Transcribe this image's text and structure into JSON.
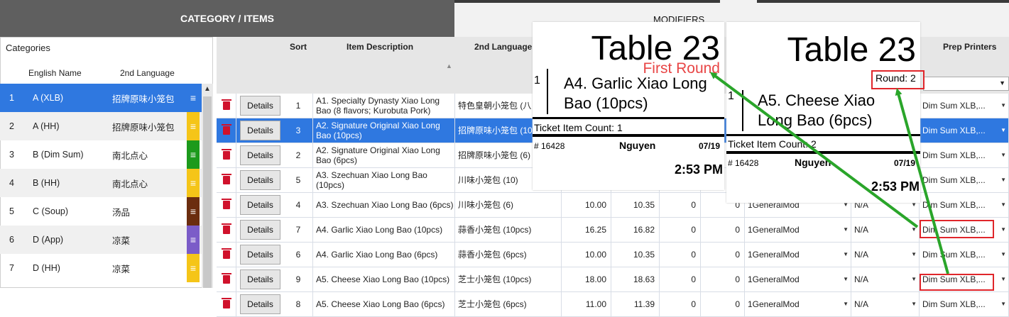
{
  "tabs": {
    "category_items": "CATEGORY / ITEMS",
    "modifiers": "MODIFIERS"
  },
  "categories": {
    "title": "Categories",
    "col_english": "English Name",
    "col_second": "2nd Language",
    "rows": [
      {
        "n": "1",
        "en": "A (XLB)",
        "l2": "招牌原味小笼包",
        "color": "#2f78e0",
        "selected": true
      },
      {
        "n": "2",
        "en": "A (HH)",
        "l2": "招牌原味小笼包",
        "color": "#f5c518"
      },
      {
        "n": "3",
        "en": "B (Dim Sum)",
        "l2": "南北点心",
        "color": "#1c9a1c"
      },
      {
        "n": "4",
        "en": "B (HH)",
        "l2": "南北点心",
        "color": "#f5c518"
      },
      {
        "n": "5",
        "en": "C (Soup)",
        "l2": "汤品",
        "color": "#6b2d0f"
      },
      {
        "n": "6",
        "en": "D (App)",
        "l2": "凉菜",
        "color": "#7b5cc8"
      },
      {
        "n": "7",
        "en": "D (HH)",
        "l2": "凉菜",
        "color": "#f5c518"
      }
    ],
    "menu_glyph": "≡"
  },
  "grid": {
    "headers": {
      "sort": "Sort",
      "desc": "Item Description",
      "l2": "2nd Language",
      "prep": "Prep Printers"
    },
    "details_label": "Details",
    "rows": [
      {
        "sort": "1",
        "desc": "A1. Specialty Dynasty Xiao Long Bao (8 flavors; Kurobuta Pork)",
        "l2": "特色皇朝小笼包 (八",
        "p1": "",
        "p2": "",
        "n1": "",
        "n2": "",
        "mod": "",
        "na": "",
        "pp": "Dim Sum XLB,..."
      },
      {
        "sort": "3",
        "desc": "A2. Signature Original Xiao Long Bao (10pcs)",
        "l2": "招牌原味小笼包 (10",
        "p1": "",
        "p2": "",
        "n1": "",
        "n2": "",
        "mod": "",
        "na": "",
        "pp": "Dim Sum XLB,...",
        "selected": true
      },
      {
        "sort": "2",
        "desc": "A2. Signature Original Xiao Long Bao (6pcs)",
        "l2": "招牌原味小笼包 (6)",
        "p1": "",
        "p2": "",
        "n1": "",
        "n2": "",
        "mod": "",
        "na": "",
        "pp": "Dim Sum XLB,..."
      },
      {
        "sort": "5",
        "desc": "A3. Szechuan Xiao Long Bao (10pcs)",
        "l2": "川味小笼包 (10)",
        "p1": "",
        "p2": "",
        "n1": "",
        "n2": "",
        "mod": "",
        "na": "",
        "pp": "Dim Sum XLB,..."
      },
      {
        "sort": "4",
        "desc": "A3. Szechuan Xiao Long Bao (6pcs)",
        "l2": "川味小笼包 (6)",
        "p1": "10.00",
        "p2": "10.35",
        "n1": "0",
        "n2": "0",
        "mod": "1GeneralMod",
        "na": "N/A",
        "pp": "Dim Sum XLB,..."
      },
      {
        "sort": "7",
        "desc": "A4. Garlic Xiao Long Bao (10pcs)",
        "l2": "蒜香小笼包  (10pcs)",
        "p1": "16.25",
        "p2": "16.82",
        "n1": "0",
        "n2": "0",
        "mod": "1GeneralMod",
        "na": "N/A",
        "pp": "Dim Sum XLB,..."
      },
      {
        "sort": "6",
        "desc": "A4. Garlic Xiao Long Bao (6pcs)",
        "l2": "蒜香小笼包  (6pcs)",
        "p1": "10.00",
        "p2": "10.35",
        "n1": "0",
        "n2": "0",
        "mod": "1GeneralMod",
        "na": "N/A",
        "pp": "Dim Sum XLB,..."
      },
      {
        "sort": "9",
        "desc": "A5. Cheese Xiao Long Bao (10pcs)",
        "l2": "芝士小笼包 (10pcs)",
        "p1": "18.00",
        "p2": "18.63",
        "n1": "0",
        "n2": "0",
        "mod": "1GeneralMod",
        "na": "N/A",
        "pp": "Dim Sum XLB,..."
      },
      {
        "sort": "8",
        "desc": "A5. Cheese Xiao Long Bao (6pcs)",
        "l2": "芝士小笼包 (6pcs)",
        "p1": "11.00",
        "p2": "11.39",
        "n1": "0",
        "n2": "0",
        "mod": "1GeneralMod",
        "na": "N/A",
        "pp": "Dim Sum XLB,..."
      }
    ]
  },
  "receipt1": {
    "table": "Table 23",
    "round": "First Round",
    "qty": "1",
    "item_line1": "A4. Garlic Xiao Long",
    "item_line2": "Bao (10pcs)",
    "count": "Ticket Item Count: 1",
    "check": "# 16428",
    "server": "Nguyen",
    "date": "07/19",
    "time": "2:53 PM",
    "round_color": "#e84545"
  },
  "receipt2": {
    "table": "Table 23",
    "round": "Round: 2",
    "qty": "1",
    "item_line1": "A5. Cheese Xiao",
    "item_line2": "Long Bao (6pcs)",
    "count": "Ticket Item Count: 2",
    "check": "# 16428",
    "server": "Nguyen",
    "date": "07/19",
    "time": "2:53 PM"
  },
  "colors": {
    "accent": "#2f78e0",
    "arrow": "#2aa52a",
    "highlight": "#e0262b"
  }
}
